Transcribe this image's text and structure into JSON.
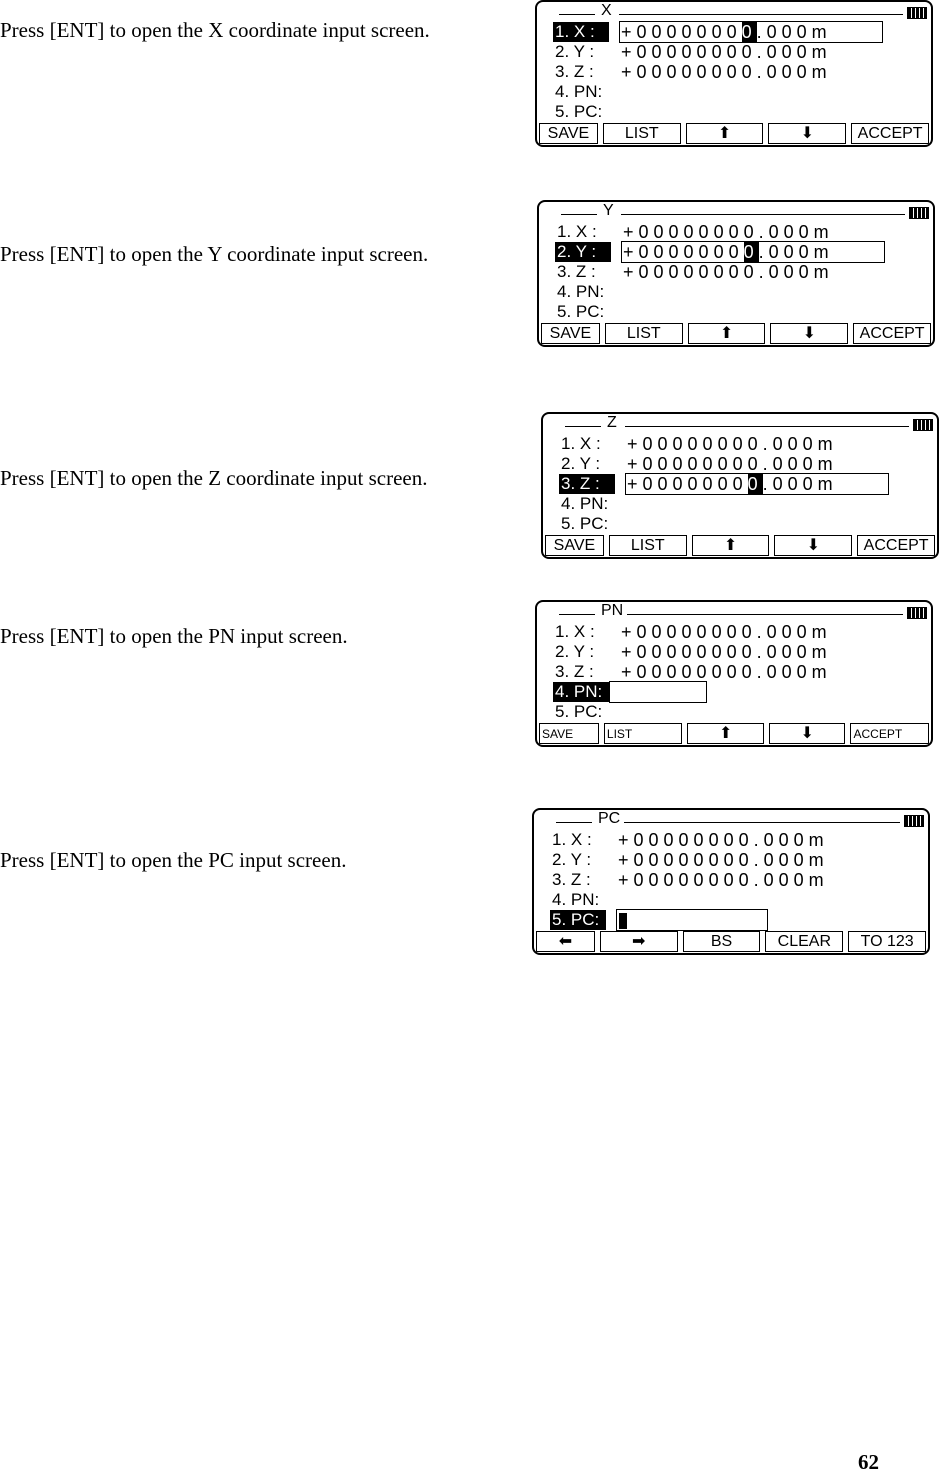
{
  "steps": [
    {
      "text": "Press [ENT] to open the X coordinate input screen.",
      "screen": {
        "title": "X",
        "selected": 0,
        "edit_value": true,
        "buttons": [
          "SAVE",
          "LIST",
          "⬆",
          "⬇",
          "ACCEPT"
        ]
      }
    },
    {
      "text": "Press [ENT] to open the Y coordinate input screen.",
      "screen": {
        "title": "Y",
        "selected": 1,
        "edit_value": true,
        "buttons": [
          "SAVE",
          "LIST",
          "⬆",
          "⬇",
          "ACCEPT"
        ]
      }
    },
    {
      "text": "Press [ENT] to open the Z coordinate input screen.",
      "screen": {
        "title": "Z",
        "selected": 2,
        "edit_value": true,
        "buttons": [
          "SAVE",
          "LIST",
          "⬆",
          "⬇",
          "ACCEPT"
        ]
      }
    },
    {
      "text": "Press [ENT] to open the PN input screen.",
      "screen": {
        "title": "PN",
        "selected": 3,
        "edit_value": false,
        "buttons": [
          "SAVE",
          "LIST",
          "⬆",
          "⬇",
          "ACCEPT"
        ]
      }
    },
    {
      "text": "Press [ENT] to open the PC input screen.",
      "screen": {
        "title": "PC",
        "selected": 4,
        "edit_value": false,
        "buttons": [
          "⬅",
          "➡",
          "BS",
          "CLEAR",
          "TO 123"
        ]
      }
    }
  ],
  "rows": [
    {
      "label": "1. X :",
      "value": "+00000000.000m"
    },
    {
      "label": "2. Y :",
      "value": "+00000000.000m"
    },
    {
      "label": "3. Z :",
      "value": "+00000000.000m"
    },
    {
      "label": "4. PN:",
      "value": ""
    },
    {
      "label": "5. PC:",
      "value": ""
    }
  ],
  "page_number": "62"
}
